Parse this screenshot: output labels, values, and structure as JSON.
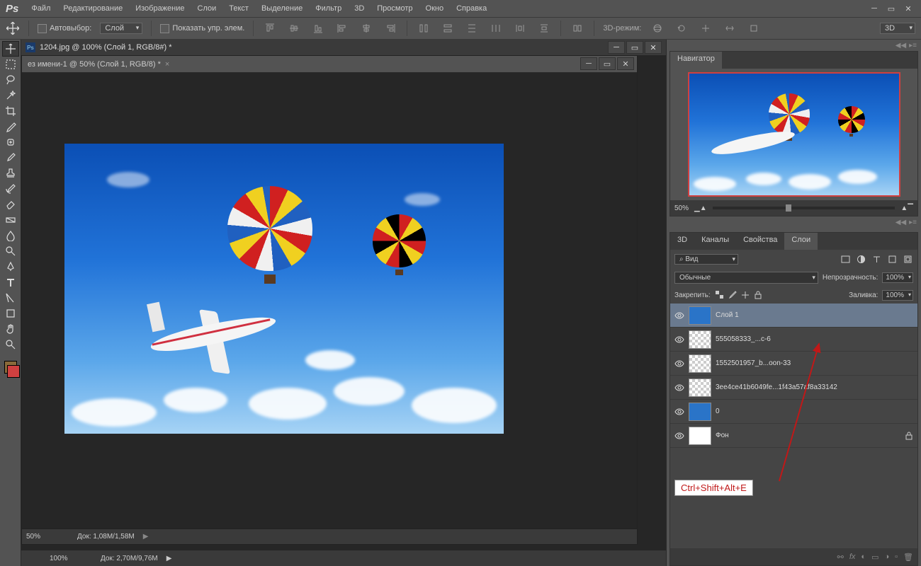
{
  "menubar": {
    "logo": "Ps",
    "items": [
      "Файл",
      "Редактирование",
      "Изображение",
      "Слои",
      "Текст",
      "Выделение",
      "Фильтр",
      "3D",
      "Просмотр",
      "Окно",
      "Справка"
    ]
  },
  "options": {
    "autoselect": "Автовыбор:",
    "layer_select": "Слой",
    "show_controls": "Показать упр. элем.",
    "mode_3d_label": "3D-режим:",
    "mode_3d_value": "3D"
  },
  "docs": {
    "bg_title": "1204.jpg @ 100% (Слой 1, RGB/8#) *",
    "fg_title": "ез имени-1 @ 50% (Слой 1, RGB/8) *",
    "fg_close": "×"
  },
  "status": {
    "inner_zoom": "50%",
    "inner_info": "Док: 1,08M/1,58M",
    "outer_zoom": "100%",
    "outer_info": "Док: 2,70M/9,76M",
    "arrow": "▶"
  },
  "panels": {
    "navigator_tab": "Навигатор",
    "nav_zoom": "50%",
    "tabs": [
      "3D",
      "Каналы",
      "Свойства",
      "Слои"
    ],
    "search_label": "Вид",
    "blend_mode": "Обычные",
    "opacity_label": "Непрозрачность:",
    "opacity_value": "100%",
    "lock_label": "Закрепить:",
    "fill_label": "Заливка:",
    "fill_value": "100%"
  },
  "layers": [
    {
      "name": "Слой 1",
      "thumb": "sky",
      "selected": true
    },
    {
      "name": "555058333_...c-6",
      "thumb": "checker"
    },
    {
      "name": "1552501957_b...oon-33",
      "thumb": "checker"
    },
    {
      "name": "3ee4ce41b6049fe...1f43a57af8a33142",
      "thumb": "checker"
    },
    {
      "name": "0",
      "thumb": "sky"
    },
    {
      "name": "Фон",
      "thumb": "white",
      "locked": true
    }
  ],
  "annotation": "Ctrl+Shift+Alt+E",
  "search_icon": "⌕"
}
